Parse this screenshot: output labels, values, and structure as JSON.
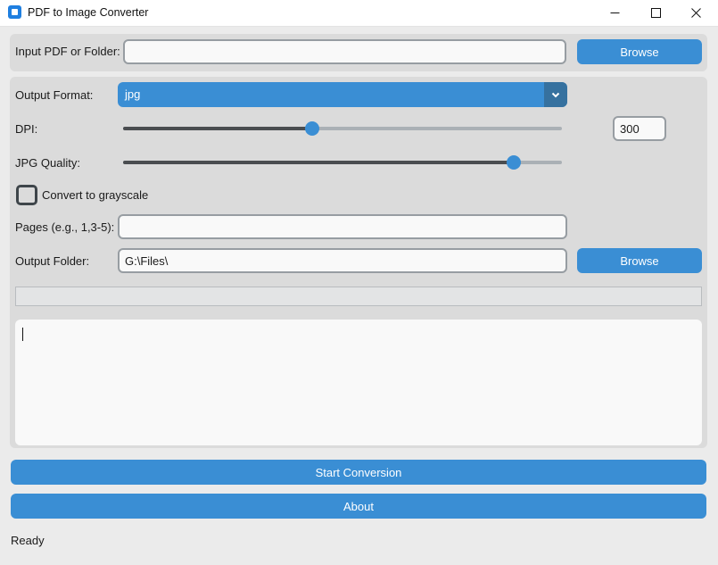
{
  "window": {
    "title": "PDF to Image Converter"
  },
  "input": {
    "label": "Input PDF or Folder:",
    "value": "",
    "browse_label": "Browse"
  },
  "output_format": {
    "label": "Output Format:",
    "selected": "jpg"
  },
  "dpi": {
    "label": "DPI:",
    "value": "300",
    "slider_level": 0.43
  },
  "jpg_quality": {
    "label": "JPG Quality:",
    "slider_level": 0.89
  },
  "grayscale": {
    "label": "Convert to grayscale",
    "checked": false
  },
  "pages": {
    "label": "Pages (e.g., 1,3-5):",
    "value": ""
  },
  "output_folder": {
    "label": "Output Folder:",
    "value": "G:\\Files\\",
    "browse_label": "Browse"
  },
  "progress": {
    "level": 0
  },
  "log": {
    "text": ""
  },
  "actions": {
    "start_label": "Start Conversion",
    "about_label": "About"
  },
  "status": {
    "text": "Ready"
  },
  "colors": {
    "accent": "#3a8ed4",
    "accent_dark": "#36719f",
    "frame_bg": "#dbdbdb",
    "window_bg": "#ebebeb"
  },
  "icons": {
    "app": "app-icon",
    "minimize": "minimize-icon",
    "maximize": "maximize-icon",
    "close": "close-icon",
    "dropdown": "chevron-down-icon"
  }
}
